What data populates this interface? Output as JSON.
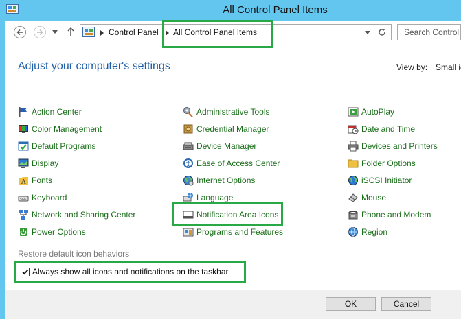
{
  "window": {
    "title": "All Control Panel Items"
  },
  "address": {
    "crumb1": "Control Panel",
    "crumb2": "All Control Panel Items",
    "search_placeholder": "Search Control Panel"
  },
  "header": {
    "heading": "Adjust your computer's settings",
    "viewby_label": "View by:",
    "viewby_value": "Small icons"
  },
  "columns": [
    [
      "Action Center",
      "Color Management",
      "Default Programs",
      "Display",
      "Fonts",
      "Keyboard",
      "Network and Sharing Center",
      "Power Options"
    ],
    [
      "Administrative Tools",
      "Credential Manager",
      "Device Manager",
      "Ease of Access Center",
      "Internet Options",
      "Language",
      "Notification Area Icons",
      "Programs and Features"
    ],
    [
      "AutoPlay",
      "Date and Time",
      "Devices and Printers",
      "Folder Options",
      "iSCSI Initiator",
      "Mouse",
      "Phone and Modem",
      "Region"
    ]
  ],
  "dialog": {
    "restore_link": "Restore default icon behaviors",
    "checkbox_label": "Always show all icons and notifications on the taskbar",
    "checkbox_checked": true,
    "ok": "OK",
    "cancel": "Cancel"
  },
  "colors": {
    "accent": "#62c6ee",
    "highlight_box": "#29a946",
    "link": "#1a6e1a"
  }
}
